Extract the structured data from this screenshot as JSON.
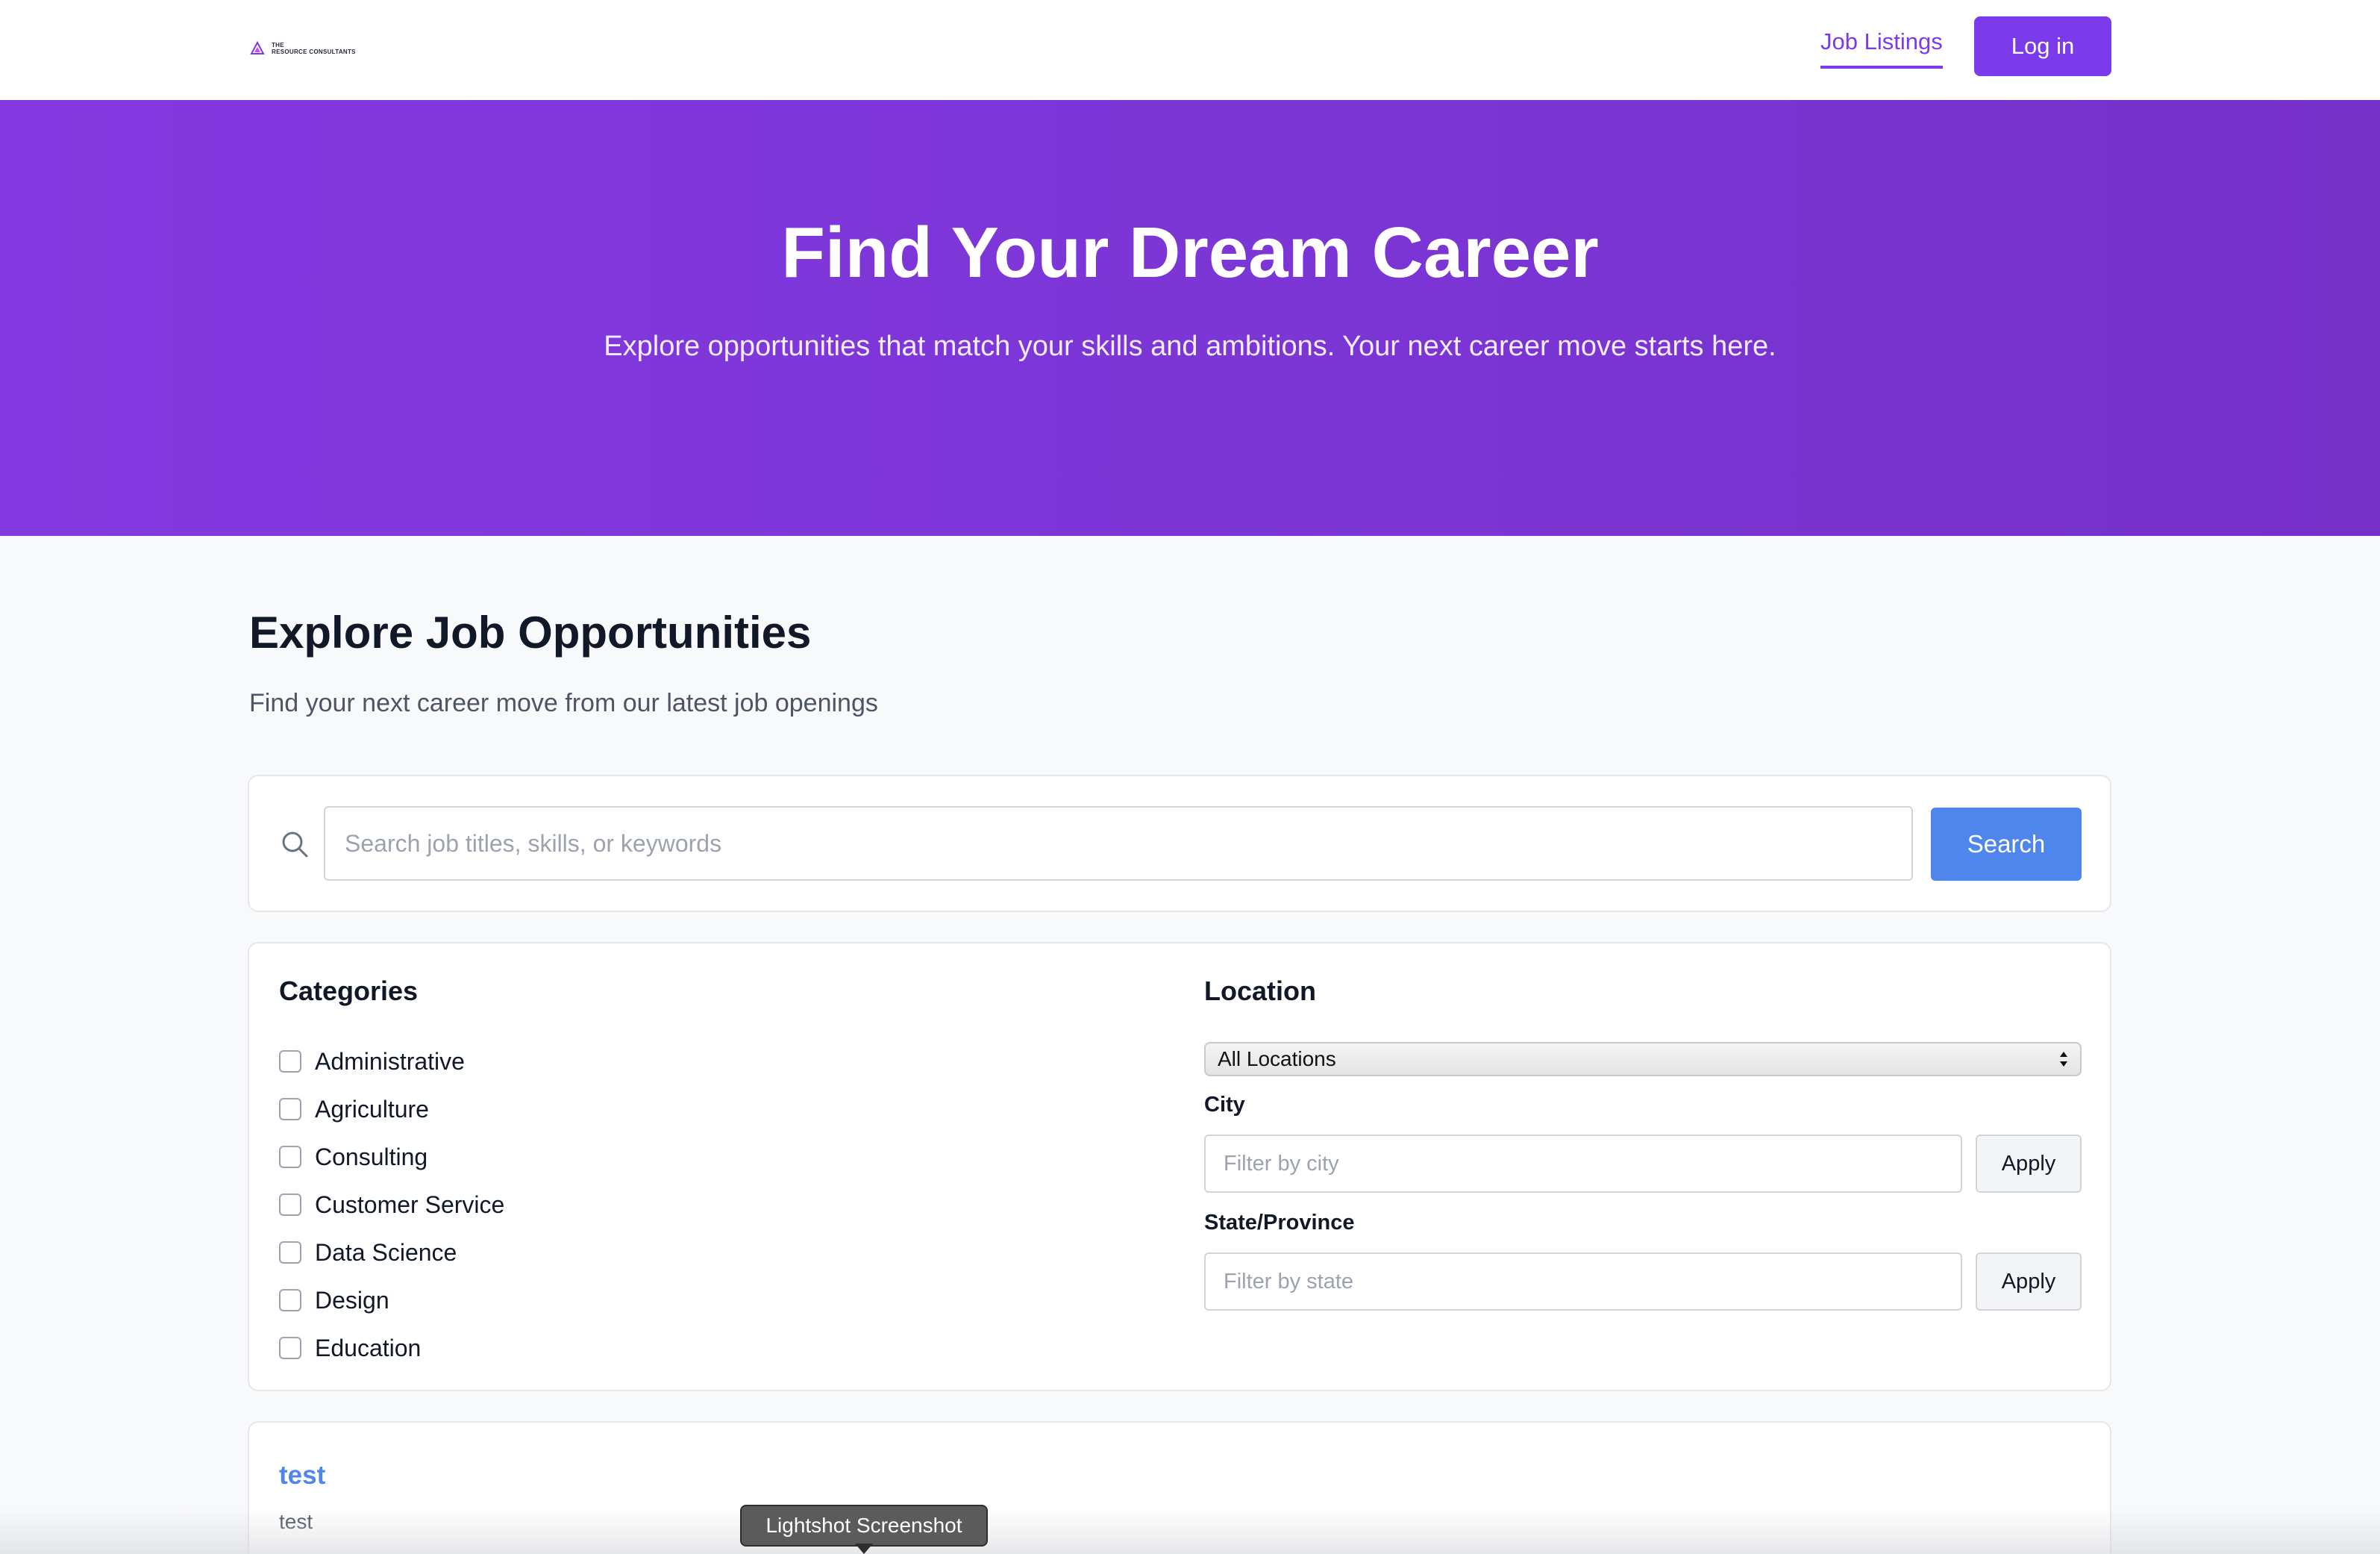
{
  "header": {
    "logo_text_top": "THE",
    "logo_text_bottom": "RESOURCE CONSULTANTS",
    "nav_link": "Job Listings",
    "login_label": "Log in"
  },
  "colors": {
    "brand": "#7c3aed",
    "accent_blue": "#4f86ec"
  },
  "hero": {
    "title": "Find Your Dream Career",
    "subtitle": "Explore opportunities that match your skills and ambitions. Your next career move starts here."
  },
  "main": {
    "title": "Explore Job Opportunities",
    "subtitle": "Find your next career move from our latest job openings"
  },
  "search": {
    "icon": "search-icon",
    "placeholder": "Search job titles, skills, or keywords",
    "value": "",
    "button_label": "Search"
  },
  "filters": {
    "categories_title": "Categories",
    "categories": [
      {
        "label": "Administrative",
        "checked": false
      },
      {
        "label": "Agriculture",
        "checked": false
      },
      {
        "label": "Consulting",
        "checked": false
      },
      {
        "label": "Customer Service",
        "checked": false
      },
      {
        "label": "Data Science",
        "checked": false
      },
      {
        "label": "Design",
        "checked": false
      },
      {
        "label": "Education",
        "checked": false
      }
    ],
    "location_title": "Location",
    "location_selected": "All Locations",
    "city_label": "City",
    "city_placeholder": "Filter by city",
    "state_label": "State/Province",
    "state_placeholder": "Filter by state",
    "apply_label": "Apply"
  },
  "jobs": [
    {
      "title": "test",
      "company": "test"
    }
  ],
  "tooltip": {
    "text": "Lightshot Screenshot"
  }
}
